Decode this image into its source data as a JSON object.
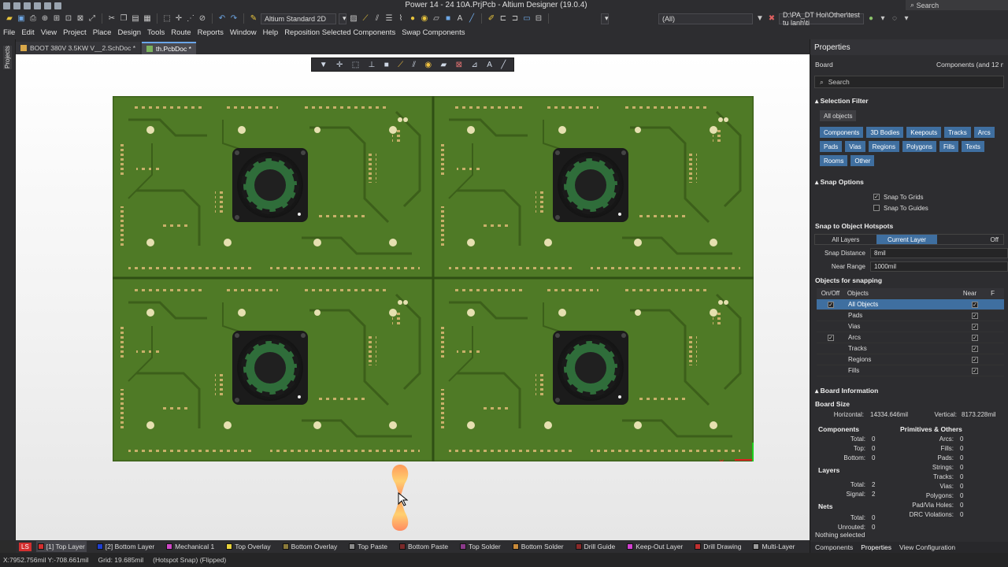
{
  "title": "Power 14 - 24 10A.PrjPcb - Altium Designer (19.0.4)",
  "title_search": "Search",
  "toolbar": {
    "layer_combo": "Altium Standard 2D",
    "filter_combo": "(All)",
    "path": "D:\\PA_DT Hoi\\Other\\test tu lanh\\ti"
  },
  "menu": [
    "File",
    "Edit",
    "View",
    "Project",
    "Place",
    "Design",
    "Tools",
    "Route",
    "Reports",
    "Window",
    "Help",
    "Reposition Selected Components",
    "Swap Components"
  ],
  "left_strip_label": "Projects",
  "doc_tabs": [
    {
      "label": "BOOT 380V 3.5KW V__2.SchDoc *",
      "active": false
    },
    {
      "label": "th.PcbDoc *",
      "active": true
    }
  ],
  "layers": [
    {
      "label": "LS",
      "color": "#d32f2f"
    },
    {
      "label": "[1] Top Layer",
      "color": "#d32f2f",
      "active": true
    },
    {
      "label": "[2] Bottom Layer",
      "color": "#1f3fd0"
    },
    {
      "label": "Mechanical 1",
      "color": "#d048c8"
    },
    {
      "label": "Top Overlay",
      "color": "#e8d23c"
    },
    {
      "label": "Bottom Overlay",
      "color": "#8a7a3a"
    },
    {
      "label": "Top Paste",
      "color": "#8a8a8a"
    },
    {
      "label": "Bottom Paste",
      "color": "#7a2a2a"
    },
    {
      "label": "Top Solder",
      "color": "#8a3a8a"
    },
    {
      "label": "Bottom Solder",
      "color": "#c88a3a"
    },
    {
      "label": "Drill Guide",
      "color": "#8a2a2a"
    },
    {
      "label": "Keep-Out Layer",
      "color": "#d040d0"
    },
    {
      "label": "Drill Drawing",
      "color": "#c03030"
    },
    {
      "label": "Multi-Layer",
      "color": "#9a9a9a"
    }
  ],
  "status": {
    "coords": "X:7952.756mil Y:-708.661mil",
    "grid": "Grid: 19.685mil",
    "snap": "(Hotspot Snap) (Flipped)"
  },
  "properties": {
    "header": "Properties",
    "board_label": "Board",
    "board_value": "Components (and 12 more)",
    "search_placeholder": "Search",
    "selection_filter": {
      "title": "Selection Filter",
      "all": "All objects",
      "chips": [
        "Components",
        "3D Bodies",
        "Keepouts",
        "Tracks",
        "Arcs",
        "Pads",
        "Vias",
        "Regions",
        "Polygons",
        "Fills",
        "Texts",
        "Rooms",
        "Other"
      ]
    },
    "snap_options": {
      "title": "Snap Options",
      "to_grids": "Snap To Grids",
      "to_guides": "Snap To Guides"
    },
    "hotspots": {
      "title": "Snap to Object Hotspots",
      "segments": [
        "All Layers",
        "Current Layer",
        "Off"
      ],
      "snap_distance_label": "Snap Distance",
      "snap_distance": "8mil",
      "near_range_label": "Near Range",
      "near_range": "1000mil"
    },
    "objects_for_snapping": {
      "title": "Objects for snapping",
      "headers": [
        "On/Off",
        "Objects",
        "Near",
        "F"
      ],
      "rows": [
        {
          "name": "All Objects",
          "on": true,
          "near": true,
          "selected": true
        },
        {
          "name": "Pads",
          "on": false,
          "near": true
        },
        {
          "name": "Vias",
          "on": false,
          "near": true
        },
        {
          "name": "Arcs",
          "on": true,
          "near": true
        },
        {
          "name": "Tracks",
          "on": false,
          "near": true
        },
        {
          "name": "Regions",
          "on": false,
          "near": true
        },
        {
          "name": "Fills",
          "on": false,
          "near": true
        }
      ]
    },
    "board_information": {
      "title": "Board Information",
      "board_size": "Board Size",
      "horizontal_label": "Horizontal:",
      "horizontal": "14334.646mil",
      "vertical_label": "Vertical:",
      "vertical": "8173.228mil",
      "components_title": "Components",
      "components": [
        [
          "Total:",
          "0"
        ],
        [
          "Top:",
          "0"
        ],
        [
          "Bottom:",
          "0"
        ]
      ],
      "layers_title": "Layers",
      "layers": [
        [
          "Total:",
          "2"
        ],
        [
          "Signal:",
          "2"
        ]
      ],
      "nets_title": "Nets",
      "nets": [
        [
          "Total:",
          "0"
        ],
        [
          "Unrouted:",
          "0"
        ]
      ],
      "primitives_title": "Primitives & Others",
      "primitives": [
        [
          "Arcs:",
          "0"
        ],
        [
          "Fills:",
          "0"
        ],
        [
          "Pads:",
          "0"
        ],
        [
          "Strings:",
          "0"
        ],
        [
          "Tracks:",
          "0"
        ],
        [
          "Vias:",
          "0"
        ],
        [
          "Polygons:",
          "0"
        ],
        [
          "Pad/Via Holes:",
          "0"
        ],
        [
          "DRC Violations:",
          "0"
        ]
      ]
    },
    "nothing_selected": "Nothing selected",
    "bottom_tabs": [
      "Components",
      "Properties",
      "View Configuration"
    ]
  }
}
